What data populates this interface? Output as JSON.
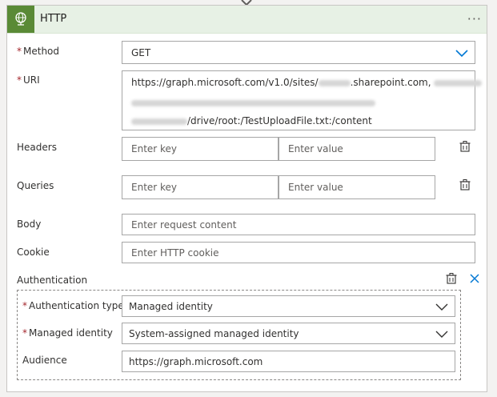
{
  "header": {
    "title": "HTTP",
    "more_label": "···"
  },
  "method": {
    "label": "Method",
    "value": "GET"
  },
  "uri": {
    "label": "URI",
    "line1_prefix": "https://graph.microsoft.com/v1.0/sites/",
    "line1_suffix": ".sharepoint.com,",
    "line3_suffix": "/drive/root:/TestUploadFile.txt:/content"
  },
  "headers": {
    "label": "Headers",
    "key_placeholder": "Enter key",
    "value_placeholder": "Enter value"
  },
  "queries": {
    "label": "Queries",
    "key_placeholder": "Enter key",
    "value_placeholder": "Enter value"
  },
  "body": {
    "label": "Body",
    "placeholder": "Enter request content"
  },
  "cookie": {
    "label": "Cookie",
    "placeholder": "Enter HTTP cookie"
  },
  "authentication": {
    "label": "Authentication",
    "type": {
      "label": "Authentication type",
      "value": "Managed identity"
    },
    "managed_identity": {
      "label": "Managed identity",
      "value": "System-assigned managed identity"
    },
    "audience": {
      "label": "Audience",
      "value": "https://graph.microsoft.com"
    }
  },
  "required_marker": "*",
  "colors": {
    "accent": "#5a8a36",
    "header_bg": "#e7f1e5",
    "link_blue": "#0078d4",
    "required": "#a4262c"
  }
}
